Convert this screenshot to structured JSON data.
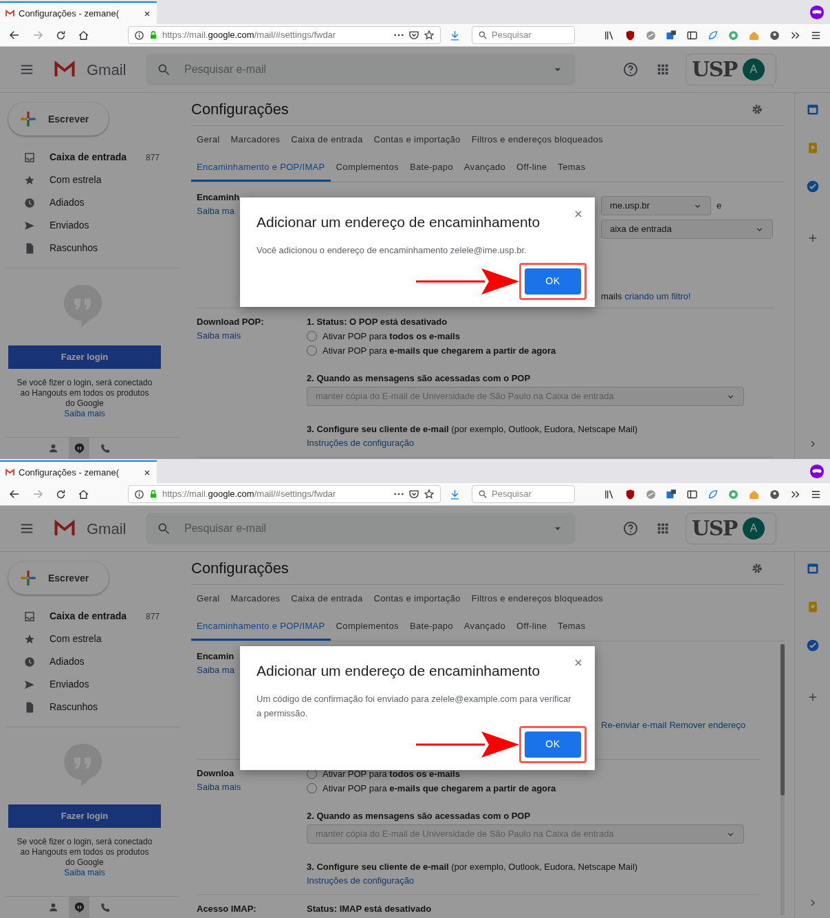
{
  "screens": [
    {
      "browser": {
        "tab_title": "Configurações - zemane(",
        "url_prefix": "https://mail.",
        "url_domain": "google.com",
        "url_path": "/mail/#settings/fwdar",
        "search_placeholder": "Pesquisar"
      },
      "gmail": {
        "product": "Gmail",
        "search_placeholder": "Pesquisar e-mail",
        "org_logo": "USP",
        "avatar": "A",
        "compose": "Escrever",
        "nav": [
          {
            "kind": "inbox",
            "label": "Caixa de entrada",
            "count": "877",
            "unread": true
          },
          {
            "kind": "star",
            "label": "Com estrela",
            "unread": false
          },
          {
            "kind": "clock",
            "label": "Adiados",
            "unread": false
          },
          {
            "kind": "send",
            "label": "Enviados",
            "unread": false
          },
          {
            "kind": "draft",
            "label": "Rascunhos",
            "unread": false
          }
        ],
        "hangouts": {
          "button": "Fazer login",
          "message": "Se você fizer o login, será conectado ao Hangouts em todos os produtos do Google",
          "link": "Saiba mais"
        },
        "footer_tabs": [
          {
            "kind": "person",
            "selected": false
          },
          {
            "kind": "chat",
            "selected": true
          },
          {
            "kind": "phone",
            "selected": false
          }
        ],
        "title": "Configurações",
        "tab_rows": [
          [
            {
              "label": "Geral",
              "selected": false
            },
            {
              "label": "Marcadores",
              "selected": false
            },
            {
              "label": "Caixa de entrada",
              "selected": false
            },
            {
              "label": "Contas e importação",
              "selected": false
            },
            {
              "label": "Filtros e endereços bloqueados",
              "selected": false
            }
          ],
          [
            {
              "label": "Encaminhamento e POP/IMAP",
              "selected": true
            },
            {
              "label": "Complementos",
              "selected": false
            },
            {
              "label": "Bate-papo",
              "selected": false
            },
            {
              "label": "Avançado",
              "selected": false
            },
            {
              "label": "Off-line",
              "selected": false
            },
            {
              "label": "Temas",
              "selected": false
            }
          ]
        ],
        "sections": [
          {
            "kind": "forwarding",
            "label": "Encaminh",
            "link": "Saiba ma",
            "items": [
              {
                "kind": "select",
                "value": "me.usp.br",
                "suffix": "e",
                "disabled": false
              },
              {
                "kind": "select",
                "value": "aixa de entrada",
                "disabled": false
              },
              {
                "kind": "text-link",
                "text": "mails",
                "link": "criando um filtro!"
              }
            ]
          },
          {
            "kind": "plain",
            "label": "Download POP:",
            "link": "Saiba mais",
            "items": [
              {
                "kind": "heading",
                "text": "**1. Status: O POP está desativado**"
              },
              {
                "kind": "radio",
                "label": "Ativar POP para **todos os e-mails**",
                "selected": false
              },
              {
                "kind": "radio",
                "label": "Ativar POP para **e-mails que chegarem a partir de agora**",
                "selected": false
              },
              {
                "kind": "heading",
                "text": "**2. Quando as mensagens são acessadas com o POP**"
              },
              {
                "kind": "select",
                "value": "manter cópia do E-mail de Universidade de São Paulo na Caixa de entrada",
                "disabled": true
              },
              {
                "kind": "note",
                "text": "**3. Configure seu cliente de e-mail** (por exemplo, Outlook, Eudora, Netscape Mail)"
              },
              {
                "kind": "link",
                "text": "Instruções de configuração"
              }
            ]
          }
        ]
      },
      "dialog": {
        "title": "Adicionar um endereço de encaminhamento",
        "message": "Você adicionou o endereço de encaminhamento zelele@ime.usp.br.",
        "button": "OK"
      }
    },
    {
      "browser": {
        "tab_title": "Configurações - zemane(",
        "url_prefix": "https://mail.",
        "url_domain": "google.com",
        "url_path": "/mail/#settings/fwdar",
        "search_placeholder": "Pesquisar"
      },
      "gmail": {
        "product": "Gmail",
        "search_placeholder": "Pesquisar e-mail",
        "org_logo": "USP",
        "avatar": "A",
        "compose": "Escrever",
        "nav": [
          {
            "kind": "inbox",
            "label": "Caixa de entrada",
            "count": "877",
            "unread": true
          },
          {
            "kind": "star",
            "label": "Com estrela",
            "unread": false
          },
          {
            "kind": "clock",
            "label": "Adiados",
            "unread": false
          },
          {
            "kind": "send",
            "label": "Enviados",
            "unread": false
          },
          {
            "kind": "draft",
            "label": "Rascunhos",
            "unread": false
          }
        ],
        "hangouts": {
          "button": "Fazer login",
          "message": "Se você fizer o login, será conectado ao Hangouts em todos os produtos do Google",
          "link": "Saiba mais"
        },
        "footer_tabs": [
          {
            "kind": "person",
            "selected": false
          },
          {
            "kind": "chat",
            "selected": true
          },
          {
            "kind": "phone",
            "selected": false
          }
        ],
        "title": "Configurações",
        "tab_rows": [
          [
            {
              "label": "Geral",
              "selected": false
            },
            {
              "label": "Marcadores",
              "selected": false
            },
            {
              "label": "Caixa de entrada",
              "selected": false
            },
            {
              "label": "Contas e importação",
              "selected": false
            },
            {
              "label": "Filtros e endereços bloqueados",
              "selected": false
            }
          ],
          [
            {
              "label": "Encaminhamento e POP/IMAP",
              "selected": true
            },
            {
              "label": "Complementos",
              "selected": false
            },
            {
              "label": "Bate-papo",
              "selected": false
            },
            {
              "label": "Avançado",
              "selected": false
            },
            {
              "label": "Off-line",
              "selected": false
            },
            {
              "label": "Temas",
              "selected": false
            }
          ]
        ],
        "sections": [
          {
            "kind": "forwarding",
            "label": "Encamin",
            "link": "Saiba ma",
            "items": [
              {
                "kind": "links",
                "links": [
                  "Re-enviar e-mail",
                  "Remover endereço"
                ]
              }
            ]
          },
          {
            "kind": "plain",
            "label": "Downloa",
            "link": "Saiba mais",
            "items": [
              {
                "kind": "radio",
                "label": "Ativar POP para **todos os e-mails**",
                "selected": false
              },
              {
                "kind": "radio",
                "label": "Ativar POP para **e-mails que chegarem a partir de agora**",
                "selected": false
              },
              {
                "kind": "heading",
                "text": "**2. Quando as mensagens são acessadas com o POP**"
              },
              {
                "kind": "select",
                "value": "manter cópia do E-mail de Universidade de São Paulo na Caixa de entrada",
                "disabled": true
              },
              {
                "kind": "note",
                "text": "**3. Configure seu cliente de e-mail** (por exemplo, Outlook, Eudora, Netscape Mail)"
              },
              {
                "kind": "link",
                "text": "Instruções de configuração"
              }
            ]
          },
          {
            "kind": "plain",
            "label": "Acesso IMAP:",
            "items": [
              {
                "kind": "heading",
                "text": "**Status: IMAP está desativado**"
              }
            ]
          }
        ]
      },
      "dialog": {
        "title": "Adicionar um endereço de encaminhamento",
        "message": "Um código de confirmação foi enviado para zelele@example.com para verificar a permissão.",
        "button": "OK"
      }
    }
  ]
}
